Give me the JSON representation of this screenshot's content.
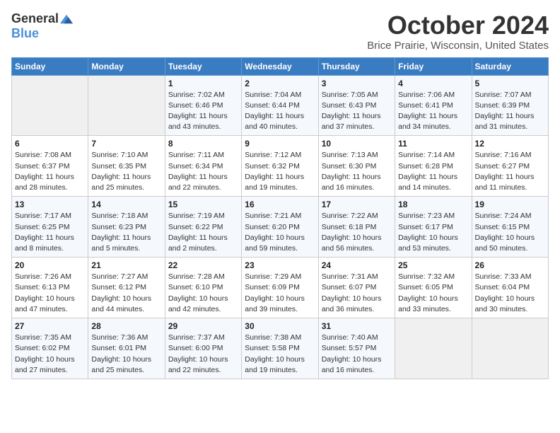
{
  "header": {
    "logo_general": "General",
    "logo_blue": "Blue",
    "month": "October 2024",
    "location": "Brice Prairie, Wisconsin, United States"
  },
  "days_of_week": [
    "Sunday",
    "Monday",
    "Tuesday",
    "Wednesday",
    "Thursday",
    "Friday",
    "Saturday"
  ],
  "weeks": [
    [
      {
        "day": "",
        "sunrise": "",
        "sunset": "",
        "daylight": ""
      },
      {
        "day": "",
        "sunrise": "",
        "sunset": "",
        "daylight": ""
      },
      {
        "day": "1",
        "sunrise": "Sunrise: 7:02 AM",
        "sunset": "Sunset: 6:46 PM",
        "daylight": "Daylight: 11 hours and 43 minutes."
      },
      {
        "day": "2",
        "sunrise": "Sunrise: 7:04 AM",
        "sunset": "Sunset: 6:44 PM",
        "daylight": "Daylight: 11 hours and 40 minutes."
      },
      {
        "day": "3",
        "sunrise": "Sunrise: 7:05 AM",
        "sunset": "Sunset: 6:43 PM",
        "daylight": "Daylight: 11 hours and 37 minutes."
      },
      {
        "day": "4",
        "sunrise": "Sunrise: 7:06 AM",
        "sunset": "Sunset: 6:41 PM",
        "daylight": "Daylight: 11 hours and 34 minutes."
      },
      {
        "day": "5",
        "sunrise": "Sunrise: 7:07 AM",
        "sunset": "Sunset: 6:39 PM",
        "daylight": "Daylight: 11 hours and 31 minutes."
      }
    ],
    [
      {
        "day": "6",
        "sunrise": "Sunrise: 7:08 AM",
        "sunset": "Sunset: 6:37 PM",
        "daylight": "Daylight: 11 hours and 28 minutes."
      },
      {
        "day": "7",
        "sunrise": "Sunrise: 7:10 AM",
        "sunset": "Sunset: 6:35 PM",
        "daylight": "Daylight: 11 hours and 25 minutes."
      },
      {
        "day": "8",
        "sunrise": "Sunrise: 7:11 AM",
        "sunset": "Sunset: 6:34 PM",
        "daylight": "Daylight: 11 hours and 22 minutes."
      },
      {
        "day": "9",
        "sunrise": "Sunrise: 7:12 AM",
        "sunset": "Sunset: 6:32 PM",
        "daylight": "Daylight: 11 hours and 19 minutes."
      },
      {
        "day": "10",
        "sunrise": "Sunrise: 7:13 AM",
        "sunset": "Sunset: 6:30 PM",
        "daylight": "Daylight: 11 hours and 16 minutes."
      },
      {
        "day": "11",
        "sunrise": "Sunrise: 7:14 AM",
        "sunset": "Sunset: 6:28 PM",
        "daylight": "Daylight: 11 hours and 14 minutes."
      },
      {
        "day": "12",
        "sunrise": "Sunrise: 7:16 AM",
        "sunset": "Sunset: 6:27 PM",
        "daylight": "Daylight: 11 hours and 11 minutes."
      }
    ],
    [
      {
        "day": "13",
        "sunrise": "Sunrise: 7:17 AM",
        "sunset": "Sunset: 6:25 PM",
        "daylight": "Daylight: 11 hours and 8 minutes."
      },
      {
        "day": "14",
        "sunrise": "Sunrise: 7:18 AM",
        "sunset": "Sunset: 6:23 PM",
        "daylight": "Daylight: 11 hours and 5 minutes."
      },
      {
        "day": "15",
        "sunrise": "Sunrise: 7:19 AM",
        "sunset": "Sunset: 6:22 PM",
        "daylight": "Daylight: 11 hours and 2 minutes."
      },
      {
        "day": "16",
        "sunrise": "Sunrise: 7:21 AM",
        "sunset": "Sunset: 6:20 PM",
        "daylight": "Daylight: 10 hours and 59 minutes."
      },
      {
        "day": "17",
        "sunrise": "Sunrise: 7:22 AM",
        "sunset": "Sunset: 6:18 PM",
        "daylight": "Daylight: 10 hours and 56 minutes."
      },
      {
        "day": "18",
        "sunrise": "Sunrise: 7:23 AM",
        "sunset": "Sunset: 6:17 PM",
        "daylight": "Daylight: 10 hours and 53 minutes."
      },
      {
        "day": "19",
        "sunrise": "Sunrise: 7:24 AM",
        "sunset": "Sunset: 6:15 PM",
        "daylight": "Daylight: 10 hours and 50 minutes."
      }
    ],
    [
      {
        "day": "20",
        "sunrise": "Sunrise: 7:26 AM",
        "sunset": "Sunset: 6:13 PM",
        "daylight": "Daylight: 10 hours and 47 minutes."
      },
      {
        "day": "21",
        "sunrise": "Sunrise: 7:27 AM",
        "sunset": "Sunset: 6:12 PM",
        "daylight": "Daylight: 10 hours and 44 minutes."
      },
      {
        "day": "22",
        "sunrise": "Sunrise: 7:28 AM",
        "sunset": "Sunset: 6:10 PM",
        "daylight": "Daylight: 10 hours and 42 minutes."
      },
      {
        "day": "23",
        "sunrise": "Sunrise: 7:29 AM",
        "sunset": "Sunset: 6:09 PM",
        "daylight": "Daylight: 10 hours and 39 minutes."
      },
      {
        "day": "24",
        "sunrise": "Sunrise: 7:31 AM",
        "sunset": "Sunset: 6:07 PM",
        "daylight": "Daylight: 10 hours and 36 minutes."
      },
      {
        "day": "25",
        "sunrise": "Sunrise: 7:32 AM",
        "sunset": "Sunset: 6:05 PM",
        "daylight": "Daylight: 10 hours and 33 minutes."
      },
      {
        "day": "26",
        "sunrise": "Sunrise: 7:33 AM",
        "sunset": "Sunset: 6:04 PM",
        "daylight": "Daylight: 10 hours and 30 minutes."
      }
    ],
    [
      {
        "day": "27",
        "sunrise": "Sunrise: 7:35 AM",
        "sunset": "Sunset: 6:02 PM",
        "daylight": "Daylight: 10 hours and 27 minutes."
      },
      {
        "day": "28",
        "sunrise": "Sunrise: 7:36 AM",
        "sunset": "Sunset: 6:01 PM",
        "daylight": "Daylight: 10 hours and 25 minutes."
      },
      {
        "day": "29",
        "sunrise": "Sunrise: 7:37 AM",
        "sunset": "Sunset: 6:00 PM",
        "daylight": "Daylight: 10 hours and 22 minutes."
      },
      {
        "day": "30",
        "sunrise": "Sunrise: 7:38 AM",
        "sunset": "Sunset: 5:58 PM",
        "daylight": "Daylight: 10 hours and 19 minutes."
      },
      {
        "day": "31",
        "sunrise": "Sunrise: 7:40 AM",
        "sunset": "Sunset: 5:57 PM",
        "daylight": "Daylight: 10 hours and 16 minutes."
      },
      {
        "day": "",
        "sunrise": "",
        "sunset": "",
        "daylight": ""
      },
      {
        "day": "",
        "sunrise": "",
        "sunset": "",
        "daylight": ""
      }
    ]
  ]
}
